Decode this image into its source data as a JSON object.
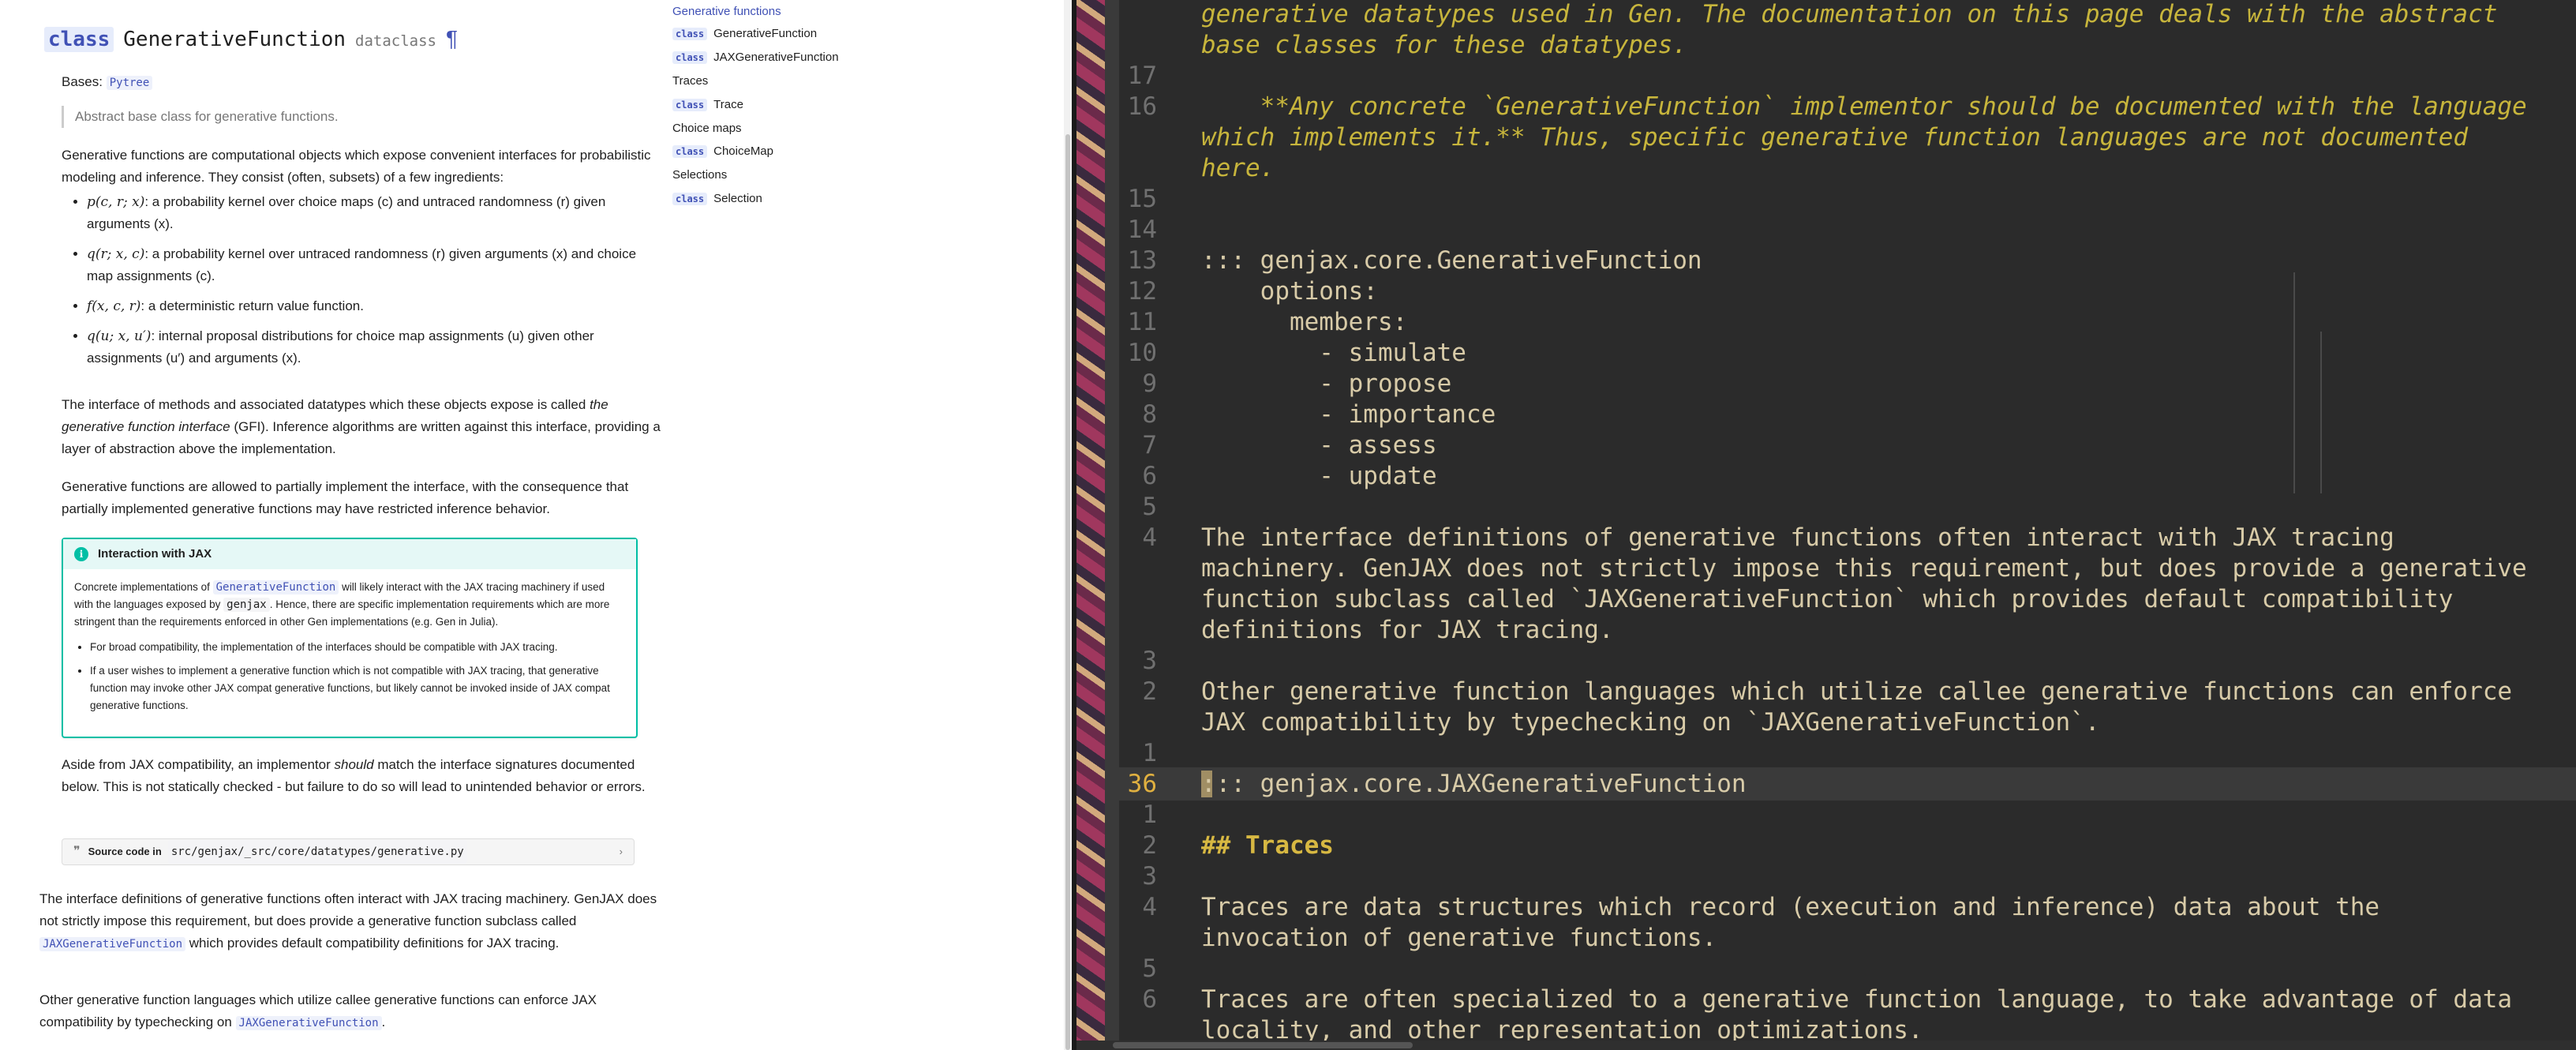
{
  "docs": {
    "heading": {
      "keyword": "class",
      "name": "GenerativeFunction",
      "decorator": "dataclass",
      "pilcrow": "¶"
    },
    "bases": {
      "label": "Bases:",
      "value": "Pytree"
    },
    "summary": "Abstract base class for generative functions.",
    "intro": "Generative functions are computational objects which expose convenient interfaces for probabilistic modeling and inference. They consist (often, subsets) of a few ingredients:",
    "ingredients": [
      {
        "math": "p(c, r; x)",
        "text": ": a probability kernel over choice maps (c) and untraced randomness (r) given arguments (x)."
      },
      {
        "math": "q(r; x, c)",
        "text": ": a probability kernel over untraced randomness (r) given arguments (x) and choice map assignments (c)."
      },
      {
        "math": "f(x, c, r)",
        "text": ": a deterministic return value function."
      },
      {
        "math": "q(u; x, u′)",
        "text": ": internal proposal distributions for choice map assignments (u) given other assignments (u′) and arguments (x)."
      }
    ],
    "interface_p": {
      "before": "The interface of methods and associated datatypes which these objects expose is called ",
      "em": "the generative function interface",
      "after": " (GFI). Inference algorithms are written against this interface, providing a layer of abstraction above the implementation."
    },
    "partial_p": "Generative functions are allowed to partially implement the interface, with the consequence that partially implemented generative functions may have restricted inference behavior.",
    "admonition": {
      "title": "Interaction with JAX",
      "body_1": "Concrete implementations of ",
      "code_1": "GenerativeFunction",
      "body_2": " will likely interact with the JAX tracing machinery if used with the languages exposed by ",
      "code_2": "genjax",
      "body_3": ". Hence, there are specific implementation requirements which are more stringent than the requirements enforced in other Gen implementations (e.g. Gen in Julia).",
      "bullets": [
        "For broad compatibility, the implementation of the interfaces should be compatible with JAX tracing.",
        "If a user wishes to implement a generative function which is not compatible with JAX tracing, that generative function may invoke other JAX compat generative functions, but likely cannot be invoked inside of JAX compat generative functions."
      ]
    },
    "aside_p": {
      "before": "Aside from JAX compatibility, an implementor ",
      "em": "should",
      "after": " match the interface signatures documented below. This is not statically checked - but failure to do so will lead to unintended behavior or errors."
    },
    "source": {
      "label": "Source code in",
      "path": "src/genjax/_src/core/datatypes/generative.py"
    },
    "tracing_p": {
      "before": "The interface definitions of generative functions often interact with JAX tracing machinery. GenJAX does not strictly impose this requirement, but does provide a generative function subclass called ",
      "code": "JAXGenerativeFunction",
      "after": " which provides default compatibility definitions for JAX tracing."
    },
    "other_p": {
      "before": "Other generative function languages which utilize callee generative functions can enforce JAX compatibility by typechecking on ",
      "code": "JAXGenerativeFunction",
      "after": "."
    }
  },
  "toc": [
    {
      "kw": "",
      "label": "Generative functions",
      "active": true
    },
    {
      "kw": "class",
      "label": "GenerativeFunction"
    },
    {
      "kw": "class",
      "label": "JAXGenerativeFunction"
    },
    {
      "kw": "",
      "label": "Traces"
    },
    {
      "kw": "class",
      "label": "Trace"
    },
    {
      "kw": "",
      "label": "Choice maps"
    },
    {
      "kw": "class",
      "label": "ChoiceMap"
    },
    {
      "kw": "",
      "label": "Selections"
    },
    {
      "kw": "class",
      "label": "Selection"
    }
  ],
  "editor": {
    "lines": [
      {
        "num": "",
        "text": "generative datatypes used in Gen. The documentation on this page deals with the abstract"
      },
      {
        "num": "",
        "text": "base classes for these datatypes."
      },
      {
        "num": "17",
        "text": ""
      },
      {
        "num": "16",
        "text": "    **Any concrete `GenerativeFunction` implementor should be documented with the language"
      },
      {
        "num": "",
        "text": "which implements it.** Thus, specific generative function languages are not documented"
      },
      {
        "num": "",
        "text": "here."
      },
      {
        "num": "15",
        "text": ""
      },
      {
        "num": "14",
        "text": ""
      },
      {
        "num": "13",
        "text": "::: genjax.core.GenerativeFunction"
      },
      {
        "num": "12",
        "text": "    options:"
      },
      {
        "num": "11",
        "text": "      members:"
      },
      {
        "num": "10",
        "text": "        - simulate"
      },
      {
        "num": "9",
        "text": "        - propose"
      },
      {
        "num": "8",
        "text": "        - importance"
      },
      {
        "num": "7",
        "text": "        - assess"
      },
      {
        "num": "6",
        "text": "        - update"
      },
      {
        "num": "5",
        "text": ""
      },
      {
        "num": "4",
        "text": "The interface definitions of generative functions often interact with JAX tracing"
      },
      {
        "num": "",
        "text": "machinery. GenJAX does not strictly impose this requirement, but does provide a generative"
      },
      {
        "num": "",
        "text": "function subclass called `JAXGenerativeFunction` which provides default compatibility"
      },
      {
        "num": "",
        "text": "definitions for JAX tracing."
      },
      {
        "num": "3",
        "text": ""
      },
      {
        "num": "2",
        "text": "Other generative function languages which utilize callee generative functions can enforce"
      },
      {
        "num": "",
        "text": "JAX compatibility by typechecking on `JAXGenerativeFunction`."
      },
      {
        "num": "1",
        "text": ""
      },
      {
        "num": "36",
        "text": "::: genjax.core.JAXGenerativeFunction",
        "current": true
      },
      {
        "num": "1",
        "text": ""
      },
      {
        "num": "2",
        "text": "## Traces"
      },
      {
        "num": "3",
        "text": ""
      },
      {
        "num": "4",
        "text": "Traces are data structures which record (execution and inference) data about the"
      },
      {
        "num": "",
        "text": "invocation of generative functions."
      },
      {
        "num": "5",
        "text": ""
      },
      {
        "num": "6",
        "text": "Traces are often specialized to a generative function language, to take advantage of data"
      },
      {
        "num": "",
        "text": "locality, and other representation optimizations."
      }
    ]
  }
}
